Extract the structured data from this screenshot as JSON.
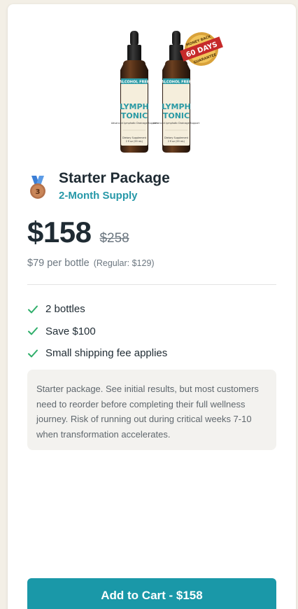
{
  "product": {
    "image_alt": "Lymph Tonic bottles",
    "bottle_label": {
      "tag": "ALCOHOL FREE",
      "line1": "LYMPH",
      "line2": "TONIC",
      "subtitle": "Advanced Lymphatic Drainage Support",
      "footer": "Dietary Supplement",
      "size": "2 fl oz (59 mL)"
    },
    "badge": {
      "top": "MONEY BACK",
      "middle": "60 DAYS",
      "bottom": "GUARANTEE"
    }
  },
  "package": {
    "medal_number": "3",
    "title": "Starter Package",
    "subtitle": "2-Month Supply"
  },
  "pricing": {
    "price": "$158",
    "original_price": "$258",
    "per_bottle": "$79 per bottle",
    "regular": "(Regular: $129)"
  },
  "features": [
    {
      "label": "2 bottles"
    },
    {
      "label": "Save $100"
    },
    {
      "label": "Small shipping fee applies"
    }
  ],
  "note": "Starter package. See initial results, but most customers need to reorder before completing their full wellness journey. Risk of running out during critical weeks 7-10 when transformation accelerates.",
  "cart_button": {
    "label": "Add to Cart - $158"
  },
  "colors": {
    "accent": "#1a98a8",
    "subtitle": "#2698a8",
    "check": "#2fae6a",
    "background": "#f3efe6"
  },
  "icons": {
    "medal": "bronze-medal-icon",
    "check": "check-icon"
  }
}
